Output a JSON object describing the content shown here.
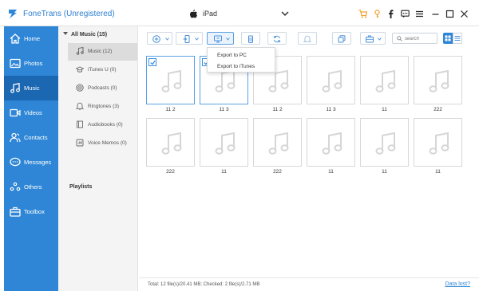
{
  "app": {
    "title": "FoneTrans (Unregistered)"
  },
  "device": {
    "name": "iPad"
  },
  "title_icons": [
    "cart-icon",
    "key-icon",
    "facebook-icon",
    "chat-icon",
    "menu-icon",
    "minimize-icon",
    "maximize-icon",
    "close-icon"
  ],
  "sidebar": {
    "items": [
      {
        "label": "Home",
        "icon": "home-icon"
      },
      {
        "label": "Photos",
        "icon": "photo-icon"
      },
      {
        "label": "Music",
        "icon": "music-icon",
        "active": true
      },
      {
        "label": "Videos",
        "icon": "video-icon"
      },
      {
        "label": "Contacts",
        "icon": "contacts-icon"
      },
      {
        "label": "Messages",
        "icon": "messages-icon"
      },
      {
        "label": "Others",
        "icon": "others-icon"
      },
      {
        "label": "Toolbox",
        "icon": "toolbox-icon"
      }
    ]
  },
  "subpanel": {
    "header": "All Music (15)",
    "items": [
      {
        "label": "Music (12)",
        "active": true
      },
      {
        "label": "iTunes U (0)"
      },
      {
        "label": "Podcasts (0)"
      },
      {
        "label": "Ringtones (3)"
      },
      {
        "label": "Audiobooks (0)"
      },
      {
        "label": "Voice Memos (0)"
      }
    ],
    "playlists": "Playlists"
  },
  "search": {
    "placeholder": "search"
  },
  "export_menu": {
    "items": [
      "Export to PC",
      "Export to iTunes"
    ]
  },
  "tiles": [
    {
      "label": "11 2",
      "checked": true
    },
    {
      "label": "11 3",
      "checked": true
    },
    {
      "label": "11 2"
    },
    {
      "label": "11 3"
    },
    {
      "label": "11"
    },
    {
      "label": "222"
    },
    {
      "label": "222"
    },
    {
      "label": "11"
    },
    {
      "label": "222"
    },
    {
      "label": "11"
    },
    {
      "label": "11"
    },
    {
      "label": "11"
    }
  ],
  "status": {
    "text": "Total: 12 file(s)/20.41 MB; Checked: 2 file(s)/2.71 MB",
    "link": "Data lost?"
  },
  "colors": {
    "accent": "#2f86d6",
    "active": "#1b67b2",
    "title": "#2e7fd0",
    "orange": "#f0a030"
  }
}
